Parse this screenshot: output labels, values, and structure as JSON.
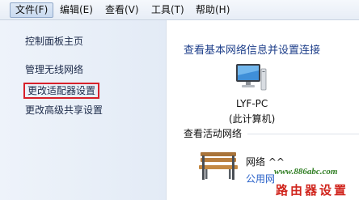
{
  "menu": {
    "items": [
      {
        "label": "文件(F)"
      },
      {
        "label": "编辑(E)"
      },
      {
        "label": "查看(V)"
      },
      {
        "label": "工具(T)"
      },
      {
        "label": "帮助(H)"
      }
    ]
  },
  "sidebar": {
    "items": [
      {
        "label": "控制面板主页"
      },
      {
        "label": "管理无线网络"
      },
      {
        "label": "更改适配器设置"
      },
      {
        "label": "更改高级共享设置"
      }
    ]
  },
  "main": {
    "title": "查看基本网络信息并设置连接",
    "computer": {
      "name": "LYF-PC",
      "subtitle": "(此计算机)",
      "icon": "computer-icon"
    },
    "active_networks": {
      "label": "查看活动网络",
      "network_name": "网络 ^^",
      "network_type": "公用网",
      "icon": "bench-icon"
    }
  },
  "watermark": {
    "url": "www.886abc.com",
    "text": "路由器设置"
  },
  "colors": {
    "highlight_border": "#d7202a",
    "title": "#1e3f8a",
    "link": "#2a62c9",
    "watermark_url": "#2e7d21",
    "watermark_text": "#d0241c"
  }
}
